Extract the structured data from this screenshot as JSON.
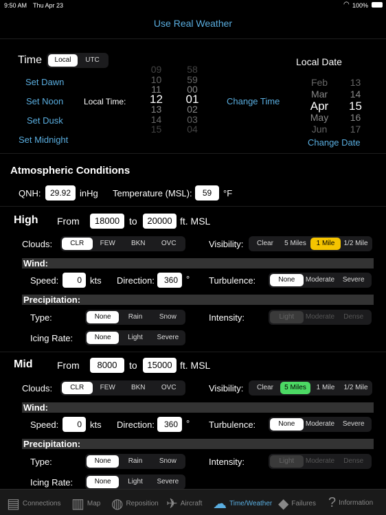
{
  "status": {
    "time": "9:50 AM",
    "date": "Thu Apr 23",
    "battery": "100%"
  },
  "real_weather": "Use Real Weather",
  "time": {
    "title": "Time",
    "modes": [
      "Local",
      "UTC"
    ],
    "selected_mode": "Local",
    "set_dawn": "Set Dawn",
    "set_noon": "Set Noon",
    "set_dusk": "Set Dusk",
    "set_midnight": "Set Midnight",
    "local_time_label": "Local Time:",
    "hours": [
      "09",
      "10",
      "11",
      "12",
      "13",
      "14",
      "15"
    ],
    "minutes": [
      "58",
      "59",
      "00",
      "01",
      "02",
      "03",
      "04"
    ],
    "selected_hour": "12",
    "selected_minute": "01",
    "change_time": "Change Time"
  },
  "date": {
    "title": "Local Date",
    "months": [
      "Feb",
      "Mar",
      "Apr",
      "May",
      "Jun"
    ],
    "days": [
      "13",
      "14",
      "15",
      "16",
      "17"
    ],
    "selected_month": "Apr",
    "selected_day": "15",
    "change_date": "Change Date"
  },
  "atmo": {
    "title": "Atmospheric Conditions",
    "qnh_label": "QNH:",
    "qnh": "29.92",
    "qnh_unit": "inHg",
    "temp_label": "Temperature (MSL):",
    "temp": "59",
    "temp_unit": "°F"
  },
  "labels": {
    "from": "From",
    "to": "to",
    "ft": "ft. MSL",
    "clouds": "Clouds:",
    "visibility": "Visibility:",
    "wind": "Wind:",
    "speed": "Speed:",
    "kts": "kts",
    "direction": "Direction:",
    "deg": "°",
    "turbulence": "Turbulence:",
    "precip": "Precipitation:",
    "type": "Type:",
    "intensity": "Intensity:",
    "icing": "Icing Rate:"
  },
  "options": {
    "clouds": [
      "CLR",
      "FEW",
      "BKN",
      "OVC"
    ],
    "visibility": [
      "Clear",
      "5 Miles",
      "1 Mile",
      "1/2 Mile"
    ],
    "turbulence": [
      "None",
      "Moderate",
      "Severe"
    ],
    "precip_type": [
      "None",
      "Rain",
      "Snow"
    ],
    "intensity": [
      "Light",
      "Moderate",
      "Dense"
    ],
    "icing": [
      "None",
      "Light",
      "Severe"
    ]
  },
  "layers": [
    {
      "name": "High",
      "from": "18000",
      "to": "20000",
      "clouds": "CLR",
      "visibility": "1 Mile",
      "visibility_color": "#f5c400",
      "speed": "0",
      "direction": "360",
      "turbulence": "None",
      "precip_type": "None",
      "intensity": "Light",
      "icing": "None"
    },
    {
      "name": "Mid",
      "from": "8000",
      "to": "15000",
      "clouds": "CLR",
      "visibility": "5 Miles",
      "visibility_color": "#4cd964",
      "speed": "0",
      "direction": "360",
      "turbulence": "None",
      "precip_type": "None",
      "intensity": "Light",
      "icing": "None"
    }
  ],
  "tabs": [
    {
      "label": "Connections",
      "icon": "computer-icon"
    },
    {
      "label": "Map",
      "icon": "map-icon"
    },
    {
      "label": "Reposition",
      "icon": "globe-icon"
    },
    {
      "label": "Aircraft",
      "icon": "airplane-icon"
    },
    {
      "label": "Time/Weather",
      "icon": "cloud-icon",
      "active": true
    },
    {
      "label": "Failures",
      "icon": "warning-icon"
    },
    {
      "label": "Information",
      "icon": "question-icon"
    }
  ]
}
